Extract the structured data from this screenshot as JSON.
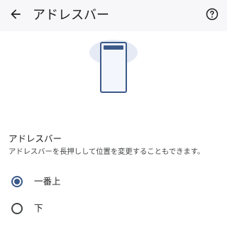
{
  "header": {
    "title": "アドレスバー",
    "back_icon": "arrow-back-icon",
    "help_icon": "help-circle-icon"
  },
  "illustration": {
    "icon": "phone-top-address-bar-illustration",
    "accent_color": "#3c5a8a",
    "halo_color": "#e5eaf5"
  },
  "setting": {
    "title": "アドレスバー",
    "description": "アドレスバーを長押しして位置を変更することもできます。"
  },
  "options": [
    {
      "label": "一番上",
      "selected": true
    },
    {
      "label": "下",
      "selected": false
    }
  ],
  "colors": {
    "toolbar_bg": "#f7f7fa",
    "radio_selected": "#3c5a8a",
    "text_primary": "#1f1f1f",
    "text_secondary": "#444746"
  }
}
